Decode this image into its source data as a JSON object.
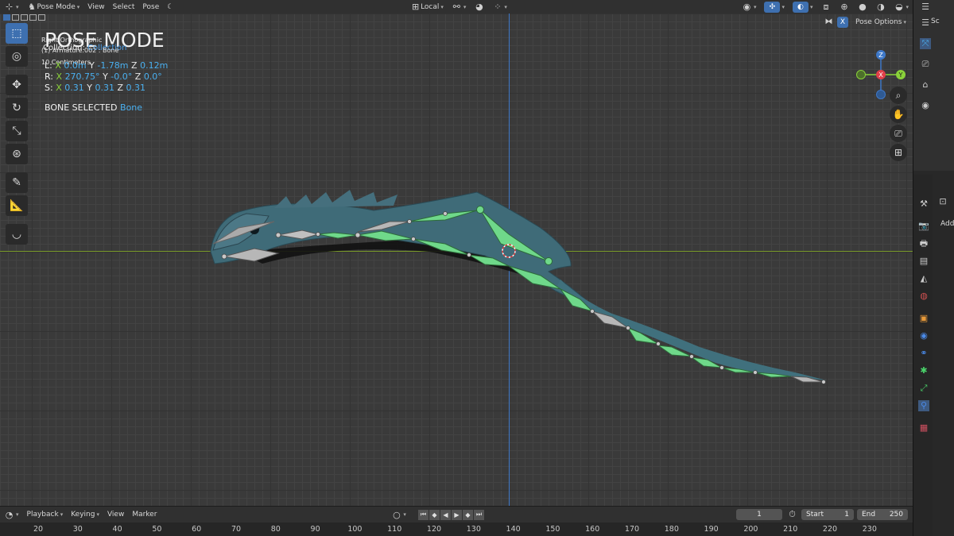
{
  "header": {
    "editor_icon": "3d-viewport-icon",
    "mode_label": "Pose Mode",
    "menus": [
      "View",
      "Select",
      "Pose"
    ],
    "orientation_label": "Local",
    "pose_options_label": "Pose Options",
    "x_mirror_label": "X"
  },
  "overlay": {
    "mode_title": "POSE MODE",
    "view_name": "Right Orthographic",
    "collection_label": "Collection",
    "object_label": "(1) Armature.002 : Bone",
    "scale_label": "10 Centimeters",
    "transform": {
      "location": {
        "label": "L:",
        "x_label": "X",
        "x": "0.0m",
        "y_label": "Y",
        "y": "-1.78m",
        "z_label": "Z",
        "z": "0.12m"
      },
      "rotation": {
        "label": "R:",
        "x_label": "X",
        "x": "270.75°",
        "y_label": "Y",
        "y": "-0.0°",
        "z_label": "Z",
        "z": "0.0°"
      },
      "scale": {
        "label": "S:",
        "x_label": "X",
        "x": "0.31",
        "y_label": "Y",
        "y": "0.31",
        "z_label": "Z",
        "z": "0.31"
      }
    },
    "bone_selected_label": "BONE SELECTED",
    "bone_name": "Bone"
  },
  "gizmo": {
    "z": "Z",
    "x": "X",
    "y": "Y"
  },
  "timeline": {
    "menus": [
      "Playback",
      "Keying",
      "View",
      "Marker"
    ],
    "current_frame": "1",
    "start_label": "Start",
    "start": "1",
    "end_label": "End",
    "end": "250",
    "ruler_ticks": [
      "20",
      "30",
      "40",
      "50",
      "60",
      "70",
      "80",
      "90",
      "100",
      "110",
      "120",
      "130",
      "140",
      "150",
      "160",
      "170",
      "180",
      "190",
      "200",
      "210",
      "220",
      "230"
    ]
  },
  "right_panel": {
    "scene_label": "Sc",
    "add_label": "Add"
  },
  "colors": {
    "accent": "#3e70b0",
    "value_blue": "#4ab0f0",
    "x_axis": "#e0404a",
    "y_axis": "#8ad23a",
    "z_axis": "#3e78c8",
    "bone_green": "#6fd88a"
  }
}
